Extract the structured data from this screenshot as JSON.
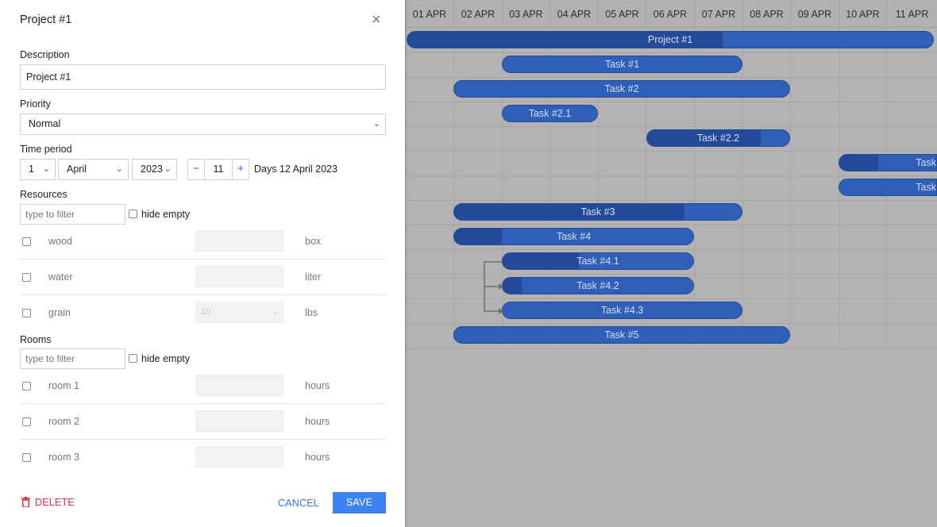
{
  "lightbox": {
    "title": "Project #1",
    "close_icon": "×",
    "description": {
      "label": "Description",
      "value": "Project #1"
    },
    "priority": {
      "label": "Priority",
      "value": "Normal"
    },
    "time_period": {
      "label": "Time period",
      "day": "1",
      "month": "April",
      "year": "2023",
      "duration": "11",
      "minus": "−",
      "plus": "+",
      "summary": "Days 12 April 2023"
    },
    "resources": {
      "label": "Resources",
      "filter_placeholder": "type to filter",
      "hide_empty": "hide empty",
      "items": [
        {
          "name": "wood",
          "value": "",
          "unit": "box"
        },
        {
          "name": "water",
          "value": "",
          "unit": "liter"
        },
        {
          "name": "grain",
          "value": "10",
          "unit": "lbs"
        }
      ]
    },
    "rooms": {
      "label": "Rooms",
      "filter_placeholder": "type to filter",
      "hide_empty": "hide empty",
      "items": [
        {
          "name": "room 1",
          "value": "",
          "unit": "hours"
        },
        {
          "name": "room 2",
          "value": "",
          "unit": "hours"
        },
        {
          "name": "room 3",
          "value": "",
          "unit": "hours"
        }
      ]
    },
    "buttons": {
      "delete": "DELETE",
      "cancel": "CANCEL",
      "save": "SAVE"
    }
  },
  "gantt": {
    "scale": [
      "01 APR",
      "02 APR",
      "03 APR",
      "04 APR",
      "05 APR",
      "06 APR",
      "07 APR",
      "08 APR",
      "09 APR",
      "10 APR",
      "11 APR"
    ],
    "tasks": [
      {
        "label": "Project #1",
        "progress": 0.6
      },
      {
        "label": "Task #1",
        "progress": 0
      },
      {
        "label": "Task #2",
        "progress": 0
      },
      {
        "label": "Task #2.1",
        "progress": 0
      },
      {
        "label": "Task #2.2",
        "progress": 0.8
      },
      {
        "label": "Task",
        "progress": 0.4
      },
      {
        "label": "Task",
        "progress": 0
      },
      {
        "label": "Task #3",
        "progress": 0.8
      },
      {
        "label": "Task #4",
        "progress": 0.2
      },
      {
        "label": "Task #4.1",
        "progress": 0.4
      },
      {
        "label": "Task #4.2",
        "progress": 0.1
      },
      {
        "label": "Task #4.3",
        "progress": 0
      },
      {
        "label": "Task #5",
        "progress": 0
      }
    ]
  },
  "colors": {
    "accent": "#3c82f0",
    "danger": "#e32d3b",
    "bar": "#2f5fb9",
    "bar_progress": "#234a99",
    "overlay": "#b3b3b3"
  }
}
